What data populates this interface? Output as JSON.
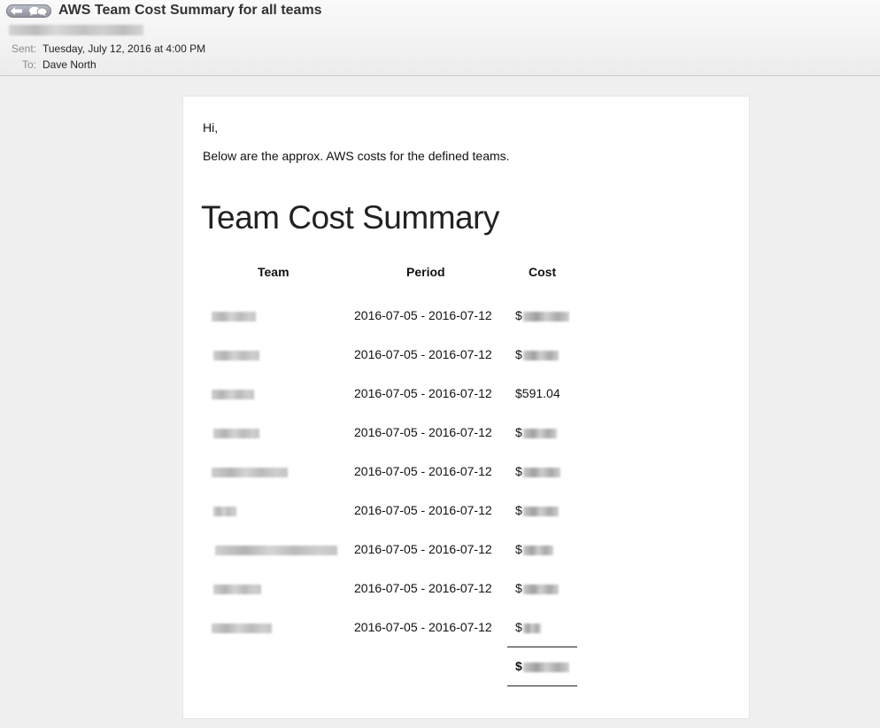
{
  "header": {
    "subject": "AWS Team Cost Summary for all teams",
    "sent_label": "Sent:",
    "sent_value": "Tuesday, July 12, 2016 at 4:00 PM",
    "to_label": "To:",
    "to_value": "Dave North"
  },
  "message": {
    "greeting": "Hi,",
    "intro": "Below are the approx. AWS costs for the defined teams.",
    "report_title": "Team Cost Summary",
    "columns": {
      "team": "Team",
      "period": "Period",
      "cost": "Cost"
    },
    "rows": [
      {
        "period": "2016-07-05 - 2016-07-12",
        "cost": "$"
      },
      {
        "period": "2016-07-05 - 2016-07-12",
        "cost": "$"
      },
      {
        "period": "2016-07-05 - 2016-07-12",
        "cost": "$591.04"
      },
      {
        "period": "2016-07-05 - 2016-07-12",
        "cost": "$"
      },
      {
        "period": "2016-07-05 - 2016-07-12",
        "cost": "$"
      },
      {
        "period": "2016-07-05 - 2016-07-12",
        "cost": "$"
      },
      {
        "period": "2016-07-05 - 2016-07-12",
        "cost": "$"
      },
      {
        "period": "2016-07-05 - 2016-07-12",
        "cost": "$"
      },
      {
        "period": "2016-07-05 - 2016-07-12",
        "cost": "$"
      }
    ],
    "total": "$"
  },
  "icons": {
    "back": "back-arrow-icon",
    "conversation": "conversation-bubbles-icon"
  }
}
